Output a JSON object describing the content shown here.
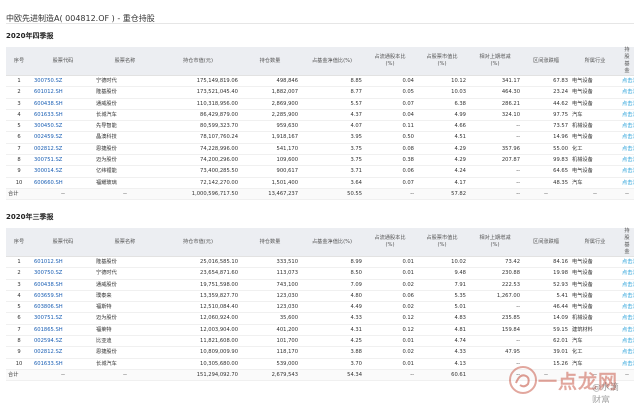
{
  "page_title": "中欧先进制造A( 004812.OF ) - 重仓持股",
  "columns": [
    "序号",
    "股票代码",
    "股票名称",
    "持仓市值(元)",
    "持仓数量",
    "占基金净值比(%)",
    "占流通股本比\n(%)",
    "占股票市值比\n(%)",
    "相对上期增减\n(%)",
    "区间涨跌幅",
    "所属行业",
    "持股基金"
  ],
  "sections": [
    {
      "title": "2020年四季报",
      "rows": [
        [
          "1",
          "300750.SZ",
          "宁德时代",
          "175,149,819.06",
          "498,846",
          "8.85",
          "0.04",
          "10.12",
          "341.17",
          "67.83",
          "电气设备",
          "点击浏览"
        ],
        [
          "2",
          "601012.SH",
          "隆基股份",
          "173,521,045.40",
          "1,882,007",
          "8.77",
          "0.05",
          "10.03",
          "464.30",
          "23.24",
          "电气设备",
          "点击浏览"
        ],
        [
          "3",
          "600438.SH",
          "通威股份",
          "110,318,956.00",
          "2,869,900",
          "5.57",
          "0.07",
          "6.38",
          "286.21",
          "44.62",
          "电气设备",
          "点击浏览"
        ],
        [
          "4",
          "601633.SH",
          "长城汽车",
          "86,429,879.00",
          "2,285,900",
          "4.37",
          "0.04",
          "4.99",
          "324.10",
          "97.75",
          "汽车",
          "点击浏览"
        ],
        [
          "5",
          "300450.SZ",
          "先导智能",
          "80,599,323.70",
          "959,630",
          "4.07",
          "0.11",
          "4.66",
          "--",
          "73.57",
          "机械设备",
          "点击浏览"
        ],
        [
          "6",
          "002459.SZ",
          "晶澳科技",
          "78,107,760.24",
          "1,918,167",
          "3.95",
          "0.50",
          "4.51",
          "--",
          "14.96",
          "电气设备",
          "点击浏览"
        ],
        [
          "7",
          "002812.SZ",
          "恩捷股份",
          "74,228,996.00",
          "541,170",
          "3.75",
          "0.08",
          "4.29",
          "357.96",
          "55.00",
          "化工",
          "点击浏览"
        ],
        [
          "8",
          "300751.SZ",
          "迈为股份",
          "74,200,296.00",
          "109,600",
          "3.75",
          "0.38",
          "4.29",
          "207.87",
          "99.83",
          "机械设备",
          "点击浏览"
        ],
        [
          "9",
          "300014.SZ",
          "亿纬锂能",
          "73,400,285.50",
          "900,617",
          "3.71",
          "0.06",
          "4.24",
          "--",
          "64.65",
          "电气设备",
          "点击浏览"
        ],
        [
          "10",
          "600660.SH",
          "福耀玻璃",
          "72,142,270.00",
          "1,501,400",
          "3.64",
          "0.07",
          "4.17",
          "--",
          "48.35",
          "汽车",
          "点击浏览"
        ]
      ],
      "total": [
        "合计",
        "--",
        "--",
        "1,000,596,717.50",
        "13,467,237",
        "50.55",
        "--",
        "57.82",
        "--",
        "--",
        "--",
        "--"
      ]
    },
    {
      "title": "2020年三季报",
      "rows": [
        [
          "1",
          "601012.SH",
          "隆基股份",
          "25,016,585.10",
          "333,510",
          "8.99",
          "0.01",
          "10.02",
          "73.42",
          "84.16",
          "电气设备",
          "点击浏览"
        ],
        [
          "2",
          "300750.SZ",
          "宁德时代",
          "23,654,871.60",
          "113,073",
          "8.50",
          "0.01",
          "9.48",
          "230.88",
          "19.98",
          "电气设备",
          "点击浏览"
        ],
        [
          "3",
          "600438.SH",
          "通威股份",
          "19,751,598.00",
          "743,100",
          "7.09",
          "0.02",
          "7.91",
          "222.53",
          "52.93",
          "电气设备",
          "点击浏览"
        ],
        [
          "4",
          "603659.SH",
          "璞泰来",
          "13,359,827.70",
          "123,030",
          "4.80",
          "0.06",
          "5.35",
          "1,267.00",
          "5.41",
          "电气设备",
          "点击浏览"
        ],
        [
          "5",
          "603806.SH",
          "福斯特",
          "12,510,084.40",
          "123,030",
          "4.49",
          "0.02",
          "5.01",
          "--",
          "46.44",
          "电气设备",
          "点击浏览"
        ],
        [
          "6",
          "300751.SZ",
          "迈为股份",
          "12,060,924.00",
          "35,600",
          "4.33",
          "0.12",
          "4.83",
          "235.85",
          "14.09",
          "机械设备",
          "点击浏览"
        ],
        [
          "7",
          "601865.SH",
          "福莱特",
          "12,003,904.00",
          "401,200",
          "4.31",
          "0.12",
          "4.81",
          "159.84",
          "59.15",
          "建筑材料",
          "点击浏览"
        ],
        [
          "8",
          "002594.SZ",
          "比亚迪",
          "11,821,608.00",
          "101,700",
          "4.25",
          "0.01",
          "4.74",
          "--",
          "62.01",
          "汽车",
          "点击浏览"
        ],
        [
          "9",
          "002812.SZ",
          "恩捷股份",
          "10,809,009.90",
          "118,170",
          "3.88",
          "0.02",
          "4.33",
          "47.95",
          "39.01",
          "化工",
          "点击浏览"
        ],
        [
          "10",
          "601633.SH",
          "长城汽车",
          "10,305,680.00",
          "539,000",
          "3.70",
          "0.01",
          "4.13",
          "--",
          "15.26",
          "汽车",
          "点击浏览"
        ]
      ],
      "total": [
        "合计",
        "--",
        "--",
        "151,294,092.70",
        "2,679,543",
        "54.34",
        "--",
        "60.61",
        "--",
        "--",
        "--",
        "--"
      ]
    }
  ],
  "watermark": {
    "text": "一点龙网",
    "sub": "@水滴财富",
    "icon": "dragon-logo-icon"
  }
}
